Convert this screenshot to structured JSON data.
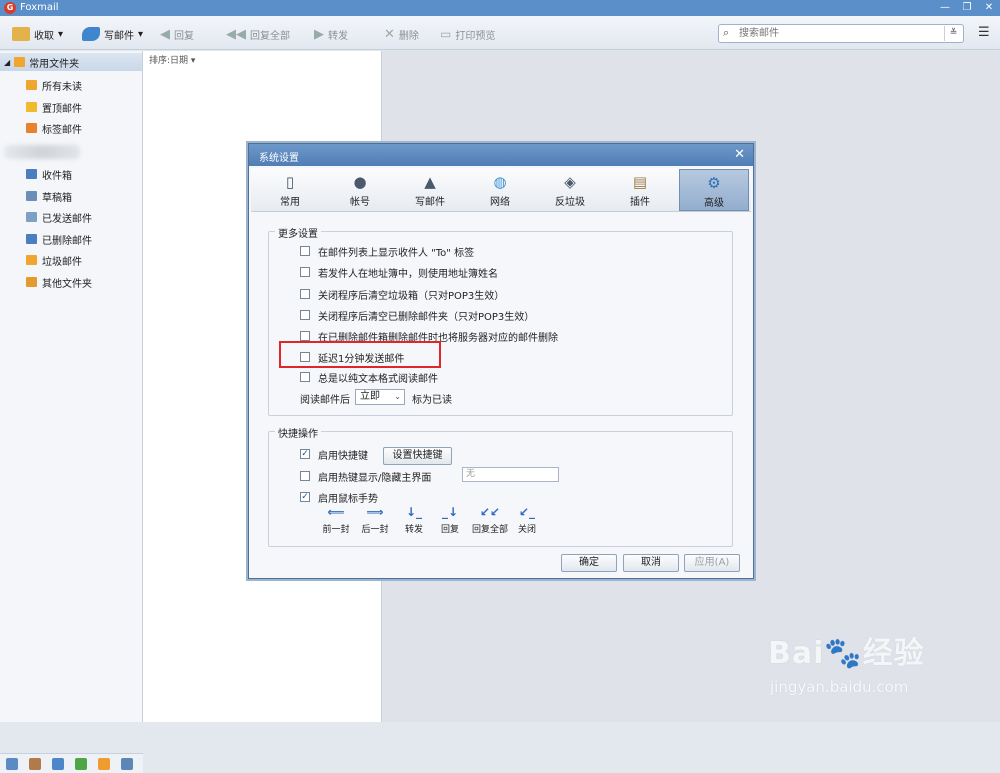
{
  "app": {
    "name": "Foxmail",
    "logo": "G"
  },
  "window_controls": {
    "minimize": "—",
    "restore": "❐",
    "close": "✕"
  },
  "toolbar": {
    "receive": "收取",
    "compose": "写邮件",
    "reply": "回复",
    "reply_all": "回复全部",
    "forward": "转发",
    "delete": "删除",
    "print_preview": "打印预览",
    "search_placeholder": "搜索邮件"
  },
  "sidebar": {
    "group": "常用文件夹",
    "top_items": [
      {
        "label": "所有未读",
        "icon": "folder-icon",
        "color": "#f0a62e"
      },
      {
        "label": "置顶邮件",
        "icon": "star-icon",
        "color": "#f0b92e"
      },
      {
        "label": "标签邮件",
        "icon": "tag-icon",
        "color": "#e6832c"
      }
    ],
    "folders": [
      {
        "label": "收件箱",
        "icon": "inbox-icon",
        "color": "#4b7ec0"
      },
      {
        "label": "草稿箱",
        "icon": "draft-icon",
        "color": "#6b8fb8"
      },
      {
        "label": "已发送邮件",
        "icon": "sent-icon",
        "color": "#7da1c6"
      },
      {
        "label": "已删除邮件",
        "icon": "trash-icon",
        "color": "#4b7ec0"
      },
      {
        "label": "垃圾邮件",
        "icon": "junk-icon",
        "color": "#f0a62e"
      },
      {
        "label": "其他文件夹",
        "icon": "folder-icon",
        "color": "#e39a2e"
      }
    ]
  },
  "list": {
    "sort_label": "排序:日期 ▾"
  },
  "dialog": {
    "title": "系统设置",
    "close": "✕",
    "tabs": [
      {
        "label": "常用",
        "icon": "▯"
      },
      {
        "label": "帐号",
        "icon": "●"
      },
      {
        "label": "写邮件",
        "icon": "▲"
      },
      {
        "label": "网络",
        "icon": "◍"
      },
      {
        "label": "反垃圾",
        "icon": "◈"
      },
      {
        "label": "插件",
        "icon": "▤"
      },
      {
        "label": "高级",
        "icon": "⚙"
      }
    ],
    "more_settings": {
      "legend": "更多设置",
      "options": [
        {
          "label": "在邮件列表上显示收件人 \"To\" 标签",
          "checked": false
        },
        {
          "label": "若发件人在地址簿中，则使用地址簿姓名",
          "checked": false
        },
        {
          "label": "关闭程序后清空垃圾箱（只对POP3生效）",
          "checked": false
        },
        {
          "label": "关闭程序后清空已删除邮件夹（只对POP3生效）",
          "checked": false
        },
        {
          "label": "在已删除邮件箱删除邮件时也将服务器对应的邮件删除",
          "checked": false
        },
        {
          "label": "延迟1分钟发送邮件",
          "checked": false
        },
        {
          "label": "总是以纯文本格式阅读邮件",
          "checked": false
        }
      ],
      "read_prefix": "阅读邮件后",
      "read_select": "立即",
      "read_suffix": "标为已读"
    },
    "shortcuts": {
      "legend": "快捷操作",
      "enable_hotkey": "启用快捷键",
      "set_hotkey_button": "设置快捷键",
      "enable_global_hotkey": "启用热键显示/隐藏主界面",
      "hotkey_value": "无",
      "enable_gestures": "启用鼠标手势",
      "gestures": [
        {
          "label": "前一封",
          "icon": "⟸"
        },
        {
          "label": "后一封",
          "icon": "⟹"
        },
        {
          "label": "转发",
          "icon": "↓_"
        },
        {
          "label": "回复",
          "icon": "_↓"
        },
        {
          "label": "回复全部",
          "icon": "↙↙"
        },
        {
          "label": "关闭",
          "icon": "↙_"
        }
      ]
    },
    "buttons": {
      "ok": "确定",
      "cancel": "取消",
      "apply": "应用(A)"
    }
  },
  "watermark": {
    "logo": "Bai🐾经验",
    "url": "jingyan.baidu.com"
  }
}
